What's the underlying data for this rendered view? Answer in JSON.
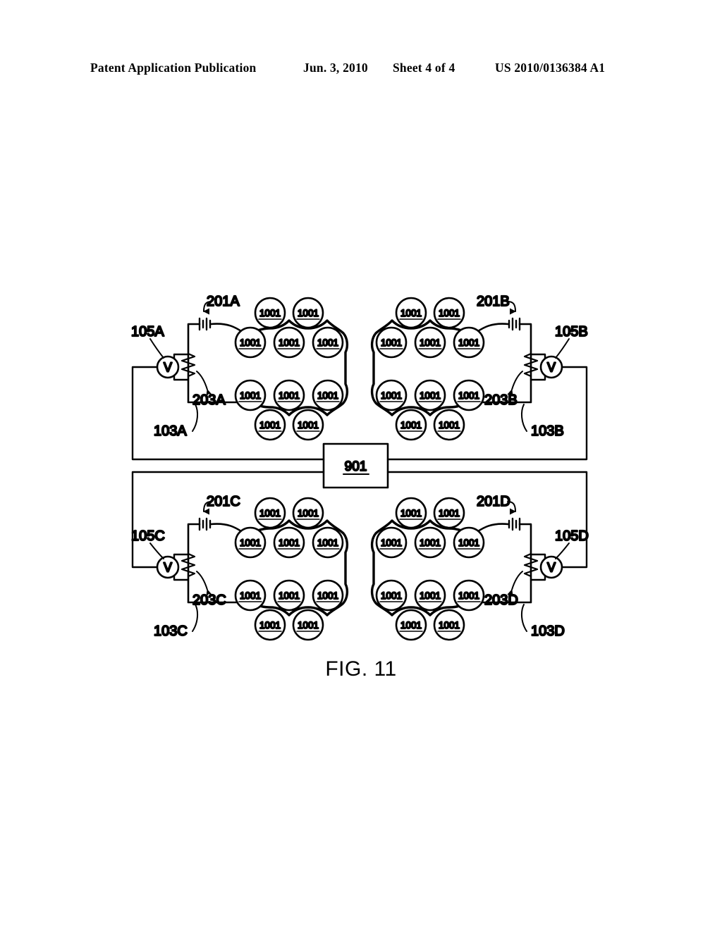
{
  "header": {
    "publication": "Patent Application Publication",
    "date": "Jun. 3, 2010",
    "sheet": "Sheet 4 of 4",
    "document_number": "US 2010/0136384 A1"
  },
  "figure": {
    "caption": "FIG. 11",
    "central_box": {
      "label": "901",
      "underlined": true
    },
    "node_label": "1001",
    "meter_symbol": "V",
    "nodes_per_block": 10,
    "blocks": [
      {
        "id": "A",
        "position": "top-left",
        "orientation": "left",
        "loop_label": "103A",
        "battery_label": "201A",
        "resistor_label": "203A",
        "meter_label": "105A",
        "nodes": [
          "1001",
          "1001",
          "1001",
          "1001",
          "1001",
          "1001",
          "1001",
          "1001",
          "1001",
          "1001"
        ]
      },
      {
        "id": "B",
        "position": "top-right",
        "orientation": "right",
        "loop_label": "103B",
        "battery_label": "201B",
        "resistor_label": "203B",
        "meter_label": "105B",
        "nodes": [
          "1001",
          "1001",
          "1001",
          "1001",
          "1001",
          "1001",
          "1001",
          "1001",
          "1001",
          "1001"
        ]
      },
      {
        "id": "C",
        "position": "bottom-left",
        "orientation": "left",
        "loop_label": "103C",
        "battery_label": "201C",
        "resistor_label": "203C",
        "meter_label": "105C",
        "nodes": [
          "1001",
          "1001",
          "1001",
          "1001",
          "1001",
          "1001",
          "1001",
          "1001",
          "1001",
          "1001"
        ]
      },
      {
        "id": "D",
        "position": "bottom-right",
        "orientation": "right",
        "loop_label": "103D",
        "battery_label": "201D",
        "resistor_label": "203D",
        "meter_label": "105D",
        "nodes": [
          "1001",
          "1001",
          "1001",
          "1001",
          "1001",
          "1001",
          "1001",
          "1001",
          "1001",
          "1001"
        ]
      }
    ],
    "colors": {
      "line": "#000000",
      "background": "#ffffff"
    }
  }
}
